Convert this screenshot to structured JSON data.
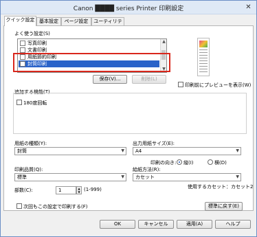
{
  "window": {
    "title": "Canon ████ series Printer 印刷設定",
    "close_glyph": "✕"
  },
  "tabs": [
    "クイック設定",
    "基本設定",
    "ページ設定",
    "ユーティリティ"
  ],
  "favorites": {
    "label": "よく使う設定(S)",
    "items": [
      "写真印刷",
      "文書印刷",
      "用紙節約印刷",
      "封筒印刷"
    ],
    "selected_index": 3,
    "save_button": "保存(V)...",
    "delete_button": "削除(L)"
  },
  "preview_checkbox": "印刷前にプレビューを表示(W)",
  "additional": {
    "label": "追加する機能(T)",
    "rotate180": "180度回転"
  },
  "media_type": {
    "label": "用紙の種類(Y):",
    "value": "封筒"
  },
  "output_size": {
    "label": "出力用紙サイズ(E):",
    "value": "A4"
  },
  "orientation": {
    "label": "印刷の向き:",
    "portrait": "縦(I)",
    "landscape": "横(D)"
  },
  "quality": {
    "label": "印刷品質(Q):",
    "value": "標準"
  },
  "source": {
    "label": "給紙方法(R):",
    "value": "カセット"
  },
  "cassette_info": "使用するカセット：カセット2",
  "copies": {
    "label": "部数(C):",
    "value": "1",
    "range": "(1-999)"
  },
  "always_print_checkbox": "次回もこの設定で印刷する(F)",
  "defaults_button": "標準に戻す(E)",
  "footer": {
    "ok": "OK",
    "cancel": "キャンセル",
    "apply": "適用(A)",
    "help": "ヘルプ"
  },
  "colors": {
    "selection": "#2a63c9",
    "highlight_border": "#d9271c"
  }
}
